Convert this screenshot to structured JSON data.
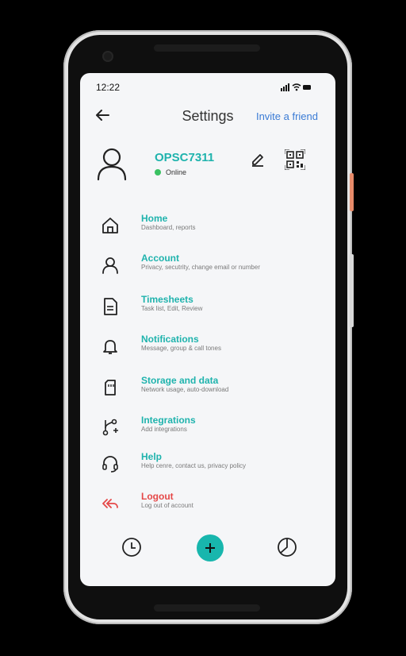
{
  "status_bar": {
    "time": "12:22"
  },
  "header": {
    "title": "Settings",
    "invite_label": "Invite a friend"
  },
  "profile": {
    "username": "OPSC7311",
    "status": "Online"
  },
  "menu": [
    {
      "icon": "home-icon",
      "title": "Home",
      "subtitle": "Dashboard, reports"
    },
    {
      "icon": "user-icon",
      "title": "Account",
      "subtitle": "Privacy, secutrity, change email or number"
    },
    {
      "icon": "document-icon",
      "title": "Timesheets",
      "subtitle": "Task list, Edit, Review"
    },
    {
      "icon": "bell-icon",
      "title": "Notifications",
      "subtitle": "Message, group & call tones"
    },
    {
      "icon": "sd-card-icon",
      "title": "Storage and data",
      "subtitle": "Network usage, auto-download"
    },
    {
      "icon": "git-branch-icon",
      "title": "Integrations",
      "subtitle": "Add integrations"
    },
    {
      "icon": "headset-icon",
      "title": "Help",
      "subtitle": "Help cenre, contact us, privacy policy"
    },
    {
      "icon": "logout-icon",
      "title": "Logout",
      "subtitle": "Log out of account"
    }
  ],
  "colors": {
    "accent": "#1fb3ad",
    "link": "#3a7bd5",
    "danger": "#e54848",
    "online": "#3ac162",
    "screen_bg": "#f5f6f8"
  },
  "bottom_nav": [
    {
      "icon": "clock-icon"
    },
    {
      "icon": "plus-icon"
    },
    {
      "icon": "pie-chart-icon"
    }
  ]
}
